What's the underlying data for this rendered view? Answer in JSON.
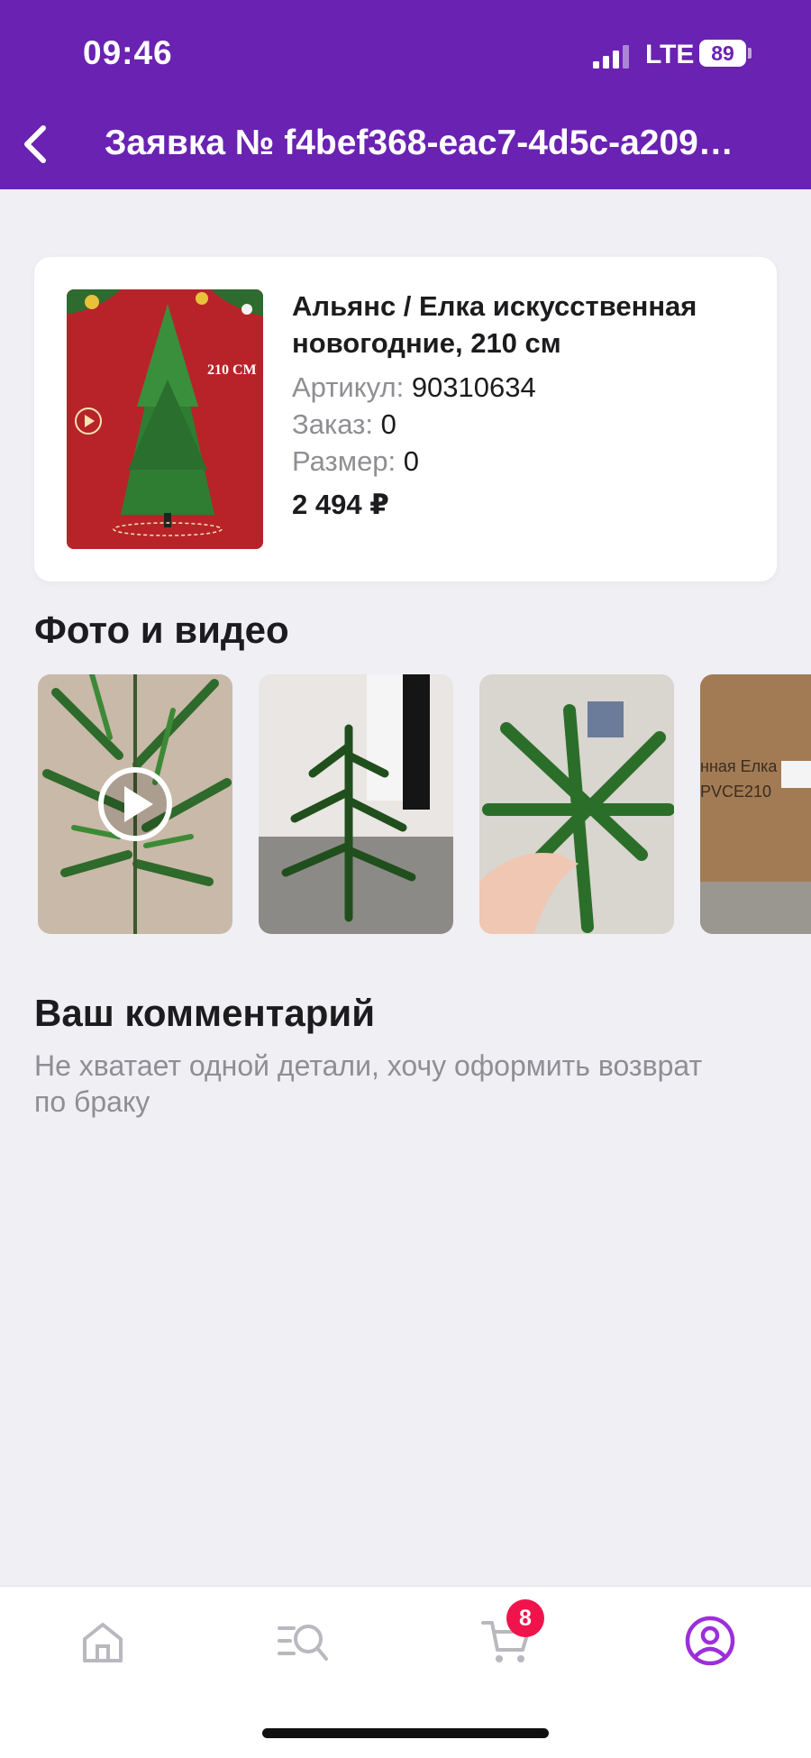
{
  "status_bar": {
    "time": "09:46",
    "network": "LTE",
    "battery": "89"
  },
  "header": {
    "title": "Заявка № f4bef368-eac7-4d5c-a209…"
  },
  "product": {
    "name": "Альянс / Елка искусственная новогодние, 210 см",
    "article_label": "Артикул:",
    "article_value": "90310634",
    "order_label": "Заказ:",
    "order_value": "0",
    "size_label": "Размер:",
    "size_value": "0",
    "price": "2 494 ₽",
    "image_text": "210 CM"
  },
  "media": {
    "title": "Фото и видео",
    "items": [
      {
        "type": "video",
        "description": "tree branches"
      },
      {
        "type": "photo",
        "description": "tree in room"
      },
      {
        "type": "photo",
        "description": "branches with hand"
      },
      {
        "type": "photo",
        "description": "cardboard box",
        "box_text_1": "нная Елка",
        "box_text_2": "PVCE210"
      }
    ]
  },
  "comment": {
    "title": "Ваш комментарий",
    "text": "Не хватает одной детали, хочу оформить возврат по браку"
  },
  "tabbar": {
    "items": [
      "home-icon",
      "catalog-search-icon",
      "cart-icon",
      "profile-icon"
    ],
    "cart_badge": "8",
    "active": "profile-icon"
  },
  "colors": {
    "brand": "#6a22b2",
    "badge": "#f0134c",
    "background": "#f0eff4",
    "active_tab": "#9b2fd9"
  }
}
